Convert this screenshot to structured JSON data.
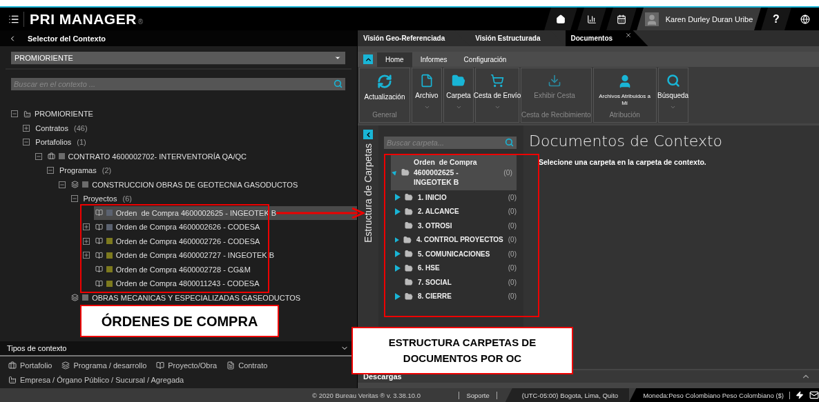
{
  "header": {
    "logo": "PRI MANAGER",
    "logo_mark": "®",
    "user": "Karen Durley Duran Uribe",
    "help": "?"
  },
  "context_panel": {
    "title": "Selector del Contexto",
    "dropdown": "PROMIORIENTE",
    "search": {
      "placeholder": "Buscar en el contexto ..."
    },
    "tree": [
      {
        "kind": "company",
        "label": "PROMIORIENTE",
        "expanded": true,
        "children": [
          {
            "label": "Contratos",
            "count": "(46)",
            "expanded": false
          },
          {
            "label": "Portafolios",
            "count": "(1)",
            "expanded": true,
            "children": [
              {
                "kind": "portfolio",
                "color": "#6b6b6b",
                "label": "CONTRATO 4600002702- INTERVENTORÍA QA/QC",
                "expanded": true,
                "children": [
                  {
                    "label": "Programas",
                    "count": "(2)",
                    "expanded": true,
                    "children": [
                      {
                        "kind": "program",
                        "color": "#6b6b6b",
                        "label": "CONSTRUCCION OBRAS DE GEOTECNIA GASODUCTOS",
                        "expanded": true,
                        "children": [
                          {
                            "label": "Proyectos",
                            "count": "(6)",
                            "expanded": true,
                            "children": [
                              {
                                "kind": "project",
                                "color": "#5b6270",
                                "label": "Orden  de Compra 4600002625 - INGEOTEK B",
                                "selected": true
                              },
                              {
                                "kind": "project",
                                "color": "#5b6270",
                                "label": "Orden de Compra 4600002626 - CODESA",
                                "expanded": false,
                                "selected": false
                              },
                              {
                                "kind": "project",
                                "color": "#7d7a1e",
                                "label": "Orden de Compra 4600002726 - CODESA",
                                "expanded": false,
                                "selected": false
                              },
                              {
                                "kind": "project",
                                "color": "#7d7a1e",
                                "label": "Orden de Compra 4600002727 - INGEOTEK B",
                                "expanded": false,
                                "selected": false
                              },
                              {
                                "kind": "project",
                                "color": "#7d7a1e",
                                "label": "Orden de Compra 4600002728 - CG&M",
                                "selected": false
                              },
                              {
                                "kind": "project",
                                "color": "#7d7a1e",
                                "label": "Orden de Compra 4800011243 - CODESA",
                                "selected": false
                              }
                            ]
                          }
                        ]
                      },
                      {
                        "kind": "program",
                        "color": "#6b6b6b",
                        "label": "OBRAS MECANICAS Y ESPECIALIZADAS GASEODUCTOS"
                      }
                    ]
                  }
                ]
              }
            ]
          }
        ]
      }
    ]
  },
  "context_types": {
    "title": "Tipos de contexto",
    "items": [
      {
        "kind": "portfolio",
        "label": "Portafolio"
      },
      {
        "kind": "program",
        "label": "Programa / desarrollo"
      },
      {
        "kind": "project",
        "label": "Proyecto/Obra"
      },
      {
        "kind": "contract",
        "label": "Contrato"
      },
      {
        "kind": "company",
        "label": "Empresa / Órgano Público / Sucursal / Agregada"
      }
    ]
  },
  "doc_tabs": [
    {
      "label": "Visión Geo-Referenciada",
      "selected": false
    },
    {
      "label": "Visión Estructurada",
      "selected": false
    },
    {
      "label": "Documentos",
      "selected": true,
      "closable": true
    }
  ],
  "ribbon": {
    "tabs": [
      {
        "label": "Home",
        "selected": true
      },
      {
        "label": "Informes",
        "selected": false
      },
      {
        "label": "Configuración",
        "selected": false
      }
    ],
    "groups": [
      {
        "label": "General",
        "buttons": [
          {
            "kind": "refresh",
            "label": "Actualización",
            "menu": false,
            "disabled": false
          }
        ]
      },
      {
        "buttons": [
          {
            "kind": "file",
            "label": "Archivo",
            "menu": true,
            "disabled": false
          }
        ]
      },
      {
        "buttons": [
          {
            "kind": "folder",
            "label": "Carpeta",
            "menu": true,
            "disabled": false
          }
        ]
      },
      {
        "buttons": [
          {
            "kind": "cart",
            "label": "Cesta de Envío",
            "menu": true,
            "disabled": false
          }
        ]
      },
      {
        "label": "Cesta de Recibimiento",
        "buttons": [
          {
            "kind": "basket",
            "label": "Exhibir Cesta",
            "menu": false,
            "disabled": true
          }
        ]
      },
      {
        "label": "Atribución",
        "buttons": [
          {
            "kind": "user",
            "label": "Archivos Atribuidos a Mí",
            "menu": false,
            "disabled": false,
            "small": true
          }
        ]
      },
      {
        "buttons": [
          {
            "kind": "search",
            "label": "Búsqueda",
            "menu": true,
            "disabled": false
          }
        ]
      }
    ]
  },
  "folders": {
    "title": "Estructura de Carpetas",
    "search": {
      "placeholder": "Buscar carpeta..."
    },
    "root": {
      "label": "Orden  de Compra 4600002625 - INGEOTEK B",
      "count": "(0)",
      "selected": true,
      "expanded": true,
      "children": [
        {
          "label": "1. INICIO",
          "count": "(0)",
          "has_children": true
        },
        {
          "label": "2. ALCANCE",
          "count": "(0)",
          "has_children": true
        },
        {
          "label": "3. OTROSI",
          "count": "(0)",
          "has_children": false
        },
        {
          "label": "4. CONTROL PROYECTOS",
          "count": "(0)",
          "has_children": true
        },
        {
          "label": "5. COMUNICACIONES",
          "count": "(0)",
          "has_children": true
        },
        {
          "label": "6. HSE",
          "count": "(0)",
          "has_children": true
        },
        {
          "label": "7. SOCIAL",
          "count": "(0)",
          "has_children": false
        },
        {
          "label": "8. CIERRE",
          "count": "(0)",
          "has_children": true
        }
      ]
    }
  },
  "content": {
    "title": "Documentos de Contexto",
    "message": "Selecione una carpeta en la carpeta de contexto."
  },
  "downloads": {
    "title": "Descargas"
  },
  "footer": {
    "copyright": "© 2020 Bureau Veritas ®  v. 3.38.10.0",
    "support": "Soporte",
    "timezone": "(UTC-05:00) Bogota, Lima, Quito",
    "currency": "Moneda:Peso Colombiano Peso Colombiano ($)"
  },
  "annotations": [
    "ÓRDENES DE COMPRA",
    "ESTRUCTURA CARPETAS DE DOCUMENTOS POR OC"
  ]
}
